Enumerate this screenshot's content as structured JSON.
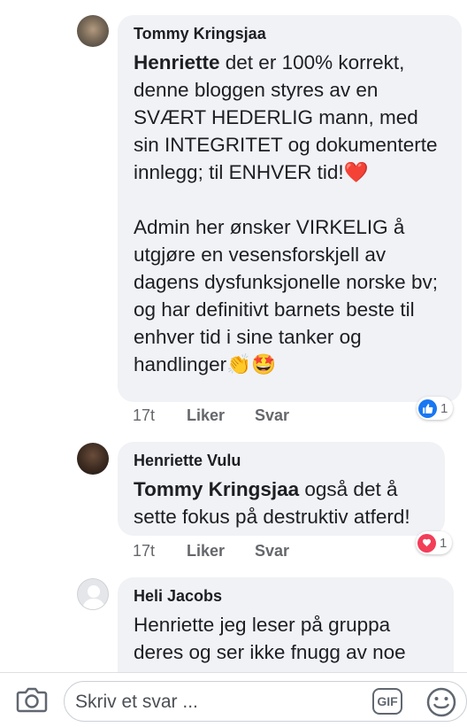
{
  "comments": [
    {
      "author": "Tommy Kringsjaa",
      "mention": "Henriette",
      "text": " det er 100% korrekt, denne bloggen styres av en SVÆRT HEDERLIG mann, med sin INTEGRITET og dokumenterte innlegg; til ENHVER tid!❤️\n\nAdmin her ønsker VIRKELIG å utgjøre en vesensforskjell av dagens dysfunksjonelle norske bv; og har definitivt barnets beste til enhver tid i sine tanker og handlinger👏🤩",
      "time": "17t",
      "like_label": "Liker",
      "reply_label": "Svar",
      "reaction": {
        "icon": "like-icon",
        "count": "1",
        "color": "#1877f2"
      }
    },
    {
      "author": "Henriette Vulu",
      "mention": "Tommy Kringsjaa",
      "text": " også det å sette fokus på destruktiv atferd!",
      "time": "17t",
      "like_label": "Liker",
      "reply_label": "Svar",
      "reaction": {
        "icon": "heart-icon",
        "count": "1",
        "color": "#f33e58"
      }
    },
    {
      "author": "Heli Jacobs",
      "mention": "",
      "text": "Henriette jeg leser på gruppa deres og ser ikke fnugg av noe",
      "time": "",
      "like_label": "",
      "reply_label": ""
    }
  ],
  "reply_bar": {
    "placeholder": "Skriv et svar ...",
    "gif_label": "GIF",
    "camera_icon": "camera-icon",
    "emoji_icon": "smiley-icon"
  }
}
